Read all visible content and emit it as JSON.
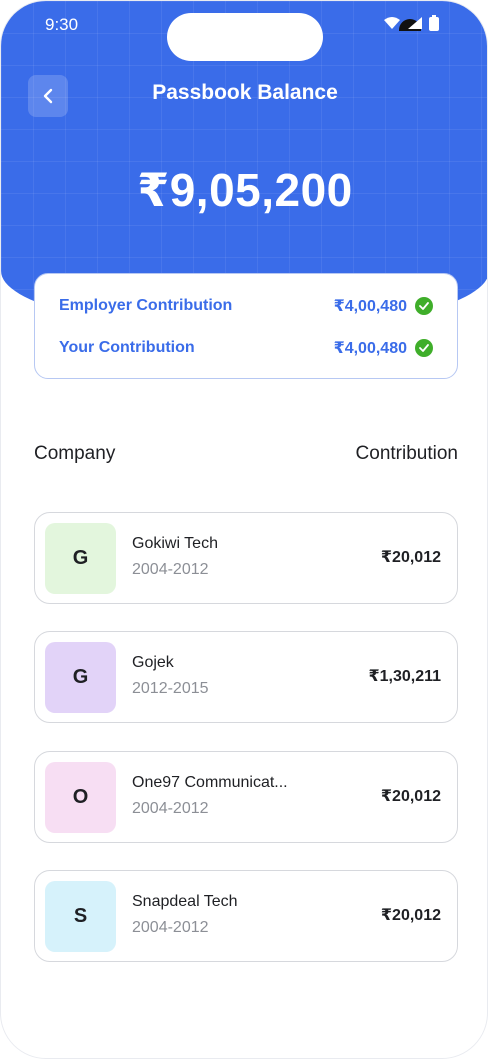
{
  "status_bar": {
    "time": "9:30"
  },
  "header": {
    "title": "Passbook Balance",
    "balance": "₹9,05,200"
  },
  "summary": [
    {
      "label": "Employer Contribution",
      "value": "₹4,00,480"
    },
    {
      "label": "Your Contribution",
      "value": "₹4,00,480"
    }
  ],
  "list_header": {
    "company": "Company",
    "contribution": "Contribution"
  },
  "companies": [
    {
      "initial": "G",
      "name": "Gokiwi Tech",
      "years": "2004-2012",
      "amount": "₹20,012",
      "color": "#e3f6dd"
    },
    {
      "initial": "G",
      "name": "Gojek",
      "years": "2012-2015",
      "amount": "₹1,30,211",
      "color": "#e2d3f8"
    },
    {
      "initial": "O",
      "name": "One97 Communicat...",
      "years": "2004-2012",
      "amount": "₹20,012",
      "color": "#f7def3"
    },
    {
      "initial": "S",
      "name": "Snapdeal Tech",
      "years": "2004-2012",
      "amount": "₹20,012",
      "color": "#d6f2fb"
    }
  ],
  "colors": {
    "accent": "#3a6ce9",
    "check": "#3fae2a"
  },
  "icons": {
    "back": "chevron-left-icon",
    "verified": "check-circle-icon"
  }
}
